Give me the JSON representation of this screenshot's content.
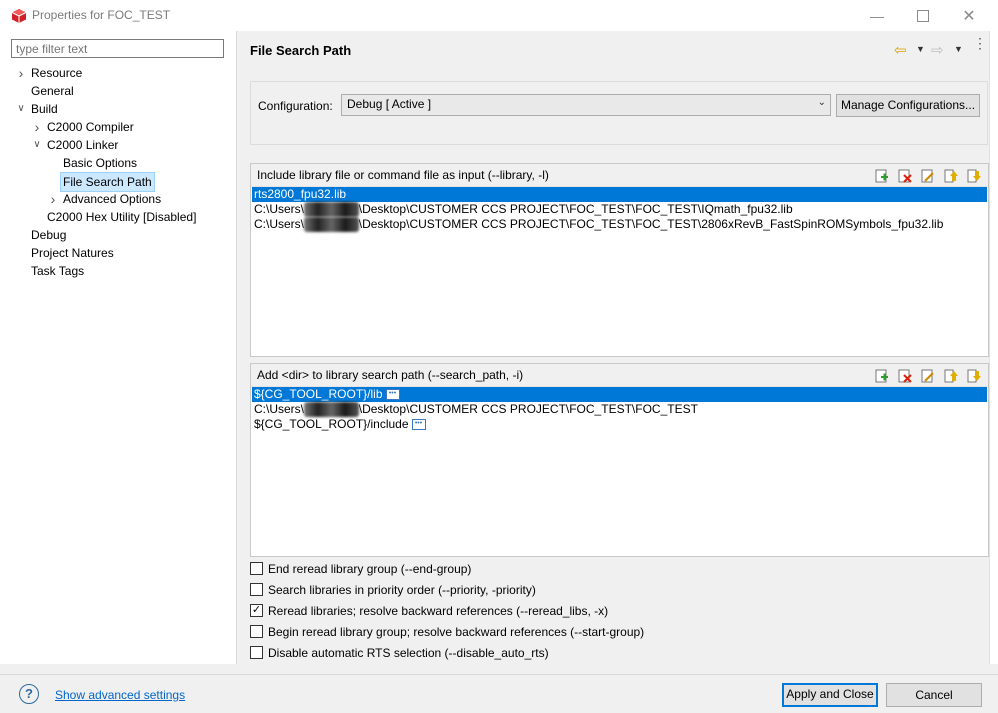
{
  "window": {
    "title": "Properties for FOC_TEST"
  },
  "filter": {
    "placeholder": "type filter text"
  },
  "tree": [
    {
      "label": "Resource",
      "indent": 0,
      "chevron": ">"
    },
    {
      "label": "General",
      "indent": 0,
      "chevron": ""
    },
    {
      "label": "Build",
      "indent": 0,
      "chevron": "v"
    },
    {
      "label": "C2000 Compiler",
      "indent": 1,
      "chevron": ">"
    },
    {
      "label": "C2000 Linker",
      "indent": 1,
      "chevron": "v"
    },
    {
      "label": "Basic Options",
      "indent": 2,
      "chevron": ""
    },
    {
      "label": "File Search Path",
      "indent": 2,
      "chevron": "",
      "selected": true
    },
    {
      "label": "Advanced Options",
      "indent": 2,
      "chevron": ">"
    },
    {
      "label": "C2000 Hex Utility  [Disabled]",
      "indent": 1,
      "chevron": ""
    },
    {
      "label": "Debug",
      "indent": 0,
      "chevron": ""
    },
    {
      "label": "Project Natures",
      "indent": 0,
      "chevron": ""
    },
    {
      "label": "Task Tags",
      "indent": 0,
      "chevron": ""
    }
  ],
  "page": {
    "title": "File Search Path"
  },
  "config": {
    "label": "Configuration:",
    "value": "Debug  [ Active ]",
    "manage_label": "Manage Configurations..."
  },
  "include_group": {
    "title": "Include library file or command file as input (--library, -l)",
    "items": [
      {
        "pre": "rts2800_fpu32.lib",
        "blur": "",
        "post": "",
        "selected": true
      },
      {
        "pre": "C:\\Users\\",
        "blur": "X0209763",
        "post": "\\Desktop\\CUSTOMER CCS PROJECT\\FOC_TEST\\FOC_TEST\\IQmath_fpu32.lib"
      },
      {
        "pre": "C:\\Users\\",
        "blur": "X0209763",
        "post": "\\Desktop\\CUSTOMER CCS PROJECT\\FOC_TEST\\FOC_TEST\\2806xRevB_FastSpinROMSymbols_fpu32.lib"
      }
    ]
  },
  "search_group": {
    "title": "Add <dir> to library search path (--search_path, -i)",
    "items": [
      {
        "pre": "${CG_TOOL_ROOT}/lib",
        "blur": "",
        "post": "",
        "selected": true,
        "more": true
      },
      {
        "pre": "C:\\Users\\",
        "blur": "X0209763",
        "post": "\\Desktop\\CUSTOMER CCS PROJECT\\FOC_TEST\\FOC_TEST"
      },
      {
        "pre": "${CG_TOOL_ROOT}/include",
        "blur": "",
        "post": "",
        "more": true
      }
    ]
  },
  "checkboxes": [
    {
      "label": "End reread library group (--end-group)",
      "checked": false
    },
    {
      "label": "Search libraries in priority order (--priority, -priority)",
      "checked": false
    },
    {
      "label": "Reread libraries; resolve backward references (--reread_libs, -x)",
      "checked": true
    },
    {
      "label": "Begin reread library group; resolve backward references (--start-group)",
      "checked": false
    },
    {
      "label": "Disable automatic RTS selection (--disable_auto_rts)",
      "checked": false
    }
  ],
  "footer": {
    "advanced_link": "Show advanced settings",
    "apply_label": "Apply and Close",
    "cancel_label": "Cancel"
  },
  "colors": {
    "selection": "#0078d7",
    "link": "#0066cc"
  }
}
